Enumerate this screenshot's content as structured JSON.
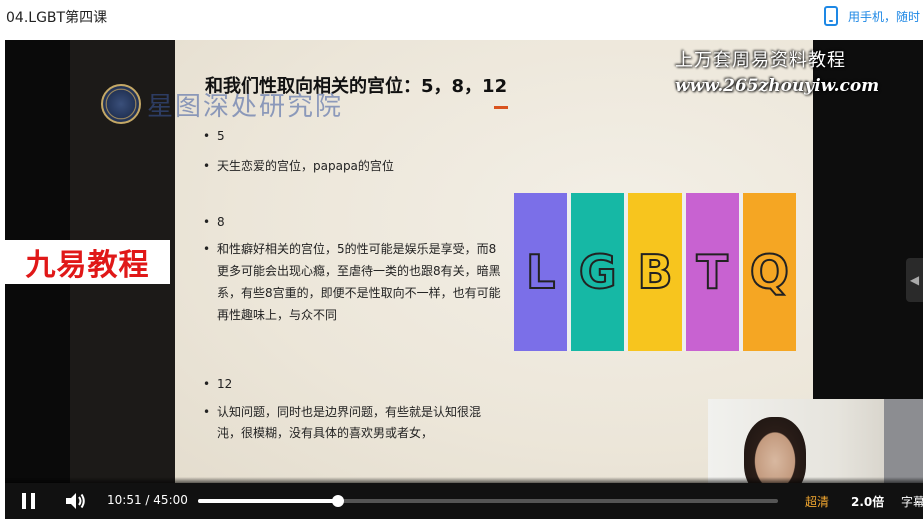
{
  "page": {
    "title": "04.LGBT第四课",
    "mobile_link": "用手机，随时"
  },
  "slide": {
    "title": "和我们性取向相关的宫位：5，8，12",
    "watermark_org": "星图深处研究院",
    "ad_line1": "上万套周易资料教程",
    "ad_line2": "www.265zhouyiw.com",
    "badge": "九易教程",
    "bullets": [
      "5",
      "天生恋爱的宫位，papapa的宫位",
      "8",
      "和性癖好相关的宫位，5的性可能是娱乐是享受，而8更多可能会出现心瘾，至虐待一类的也跟8有关，暗黑系，有些8宫重的，即便不是性取向不一样，也有可能再性趣味上，与众不同",
      "12",
      "认知问题，同时也是边界问题，有些就是认知很混沌，很模糊，没有具体的喜欢男或者女，"
    ],
    "lgbtq": [
      {
        "letter": "L",
        "color": "#7b6fe8"
      },
      {
        "letter": "G",
        "color": "#16b8a5"
      },
      {
        "letter": "B",
        "color": "#f7c51e"
      },
      {
        "letter": "T",
        "color": "#c862d1"
      },
      {
        "letter": "Q",
        "color": "#f5a623"
      }
    ]
  },
  "player": {
    "current_time": "10:51",
    "separator": "/",
    "duration": "45:00",
    "progress": 0.241,
    "quality": "超清",
    "speed": "2.0倍",
    "subtitle": "字幕"
  },
  "colors": {
    "accent_blue": "#1e88e5",
    "badge_red": "#e01818",
    "quality_orange": "#f3a830"
  }
}
